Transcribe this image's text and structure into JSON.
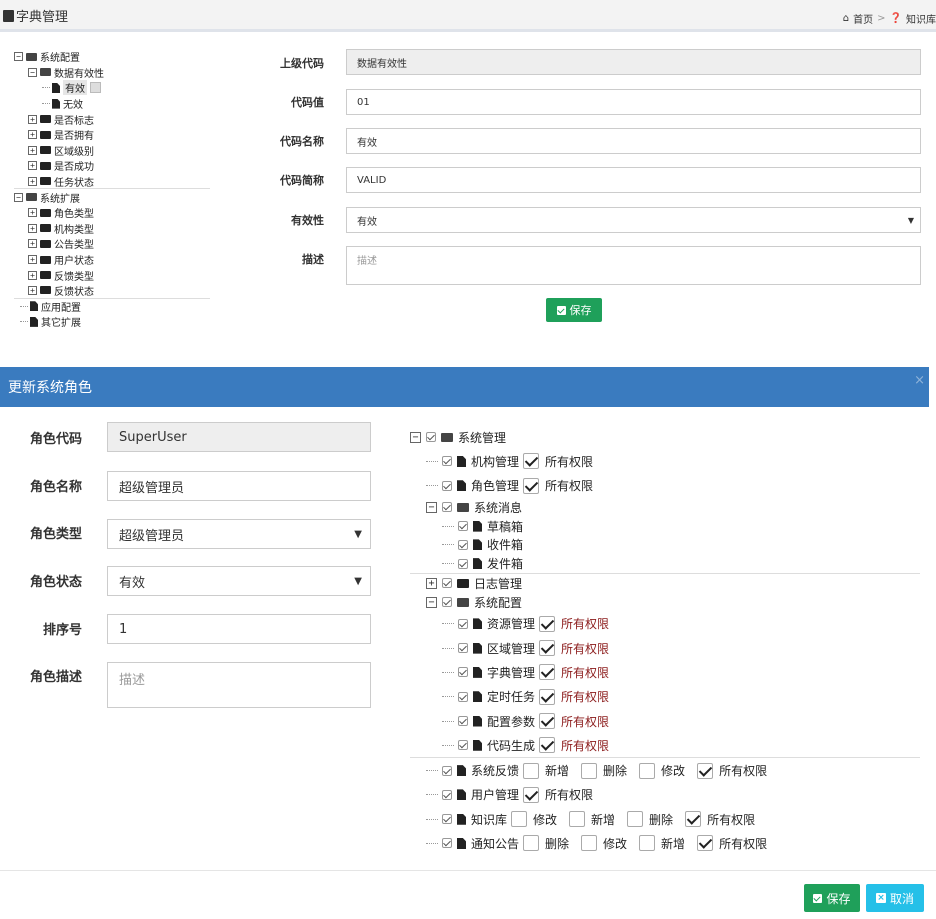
{
  "header": {
    "title": "字典管理",
    "breadcrumb": [
      "首页",
      "知识库"
    ]
  },
  "dict_tree": [
    {
      "label": "系统配置",
      "level": 0,
      "kind": "folder-open",
      "toggle": "−"
    },
    {
      "label": "数据有效性",
      "level": 1,
      "kind": "folder-open",
      "toggle": "−"
    },
    {
      "label": "有效",
      "level": 2,
      "kind": "file",
      "selected": true
    },
    {
      "label": "无效",
      "level": 2,
      "kind": "file"
    },
    {
      "label": "是否标志",
      "level": 1,
      "kind": "folder",
      "toggle": "+"
    },
    {
      "label": "是否拥有",
      "level": 1,
      "kind": "folder",
      "toggle": "+"
    },
    {
      "label": "区域级别",
      "level": 1,
      "kind": "folder",
      "toggle": "+"
    },
    {
      "label": "是否成功",
      "level": 1,
      "kind": "folder",
      "toggle": "+"
    },
    {
      "label": "任务状态",
      "level": 1,
      "kind": "folder",
      "toggle": "+"
    },
    {
      "label": "系统扩展",
      "level": 0,
      "kind": "folder-open",
      "toggle": "−"
    },
    {
      "label": "角色类型",
      "level": 1,
      "kind": "folder",
      "toggle": "+"
    },
    {
      "label": "机构类型",
      "level": 1,
      "kind": "folder",
      "toggle": "+"
    },
    {
      "label": "公告类型",
      "level": 1,
      "kind": "folder",
      "toggle": "+"
    },
    {
      "label": "用户状态",
      "level": 1,
      "kind": "folder",
      "toggle": "+"
    },
    {
      "label": "反馈类型",
      "level": 1,
      "kind": "folder",
      "toggle": "+"
    },
    {
      "label": "反馈状态",
      "level": 1,
      "kind": "folder",
      "toggle": "+"
    },
    {
      "label": "应用配置",
      "level": 0,
      "kind": "file"
    },
    {
      "label": "其它扩展",
      "level": 0,
      "kind": "file"
    }
  ],
  "dict_form": {
    "parent_code": {
      "label": "上级代码",
      "value": "数据有效性"
    },
    "code_value": {
      "label": "代码值",
      "value": "01"
    },
    "code_name": {
      "label": "代码名称",
      "value": "有效"
    },
    "code_short": {
      "label": "代码简称",
      "value": "VALID"
    },
    "validity": {
      "label": "有效性",
      "value": "有效"
    },
    "description": {
      "label": "描述",
      "placeholder": "描述"
    },
    "save_label": "保存"
  },
  "modal": {
    "title": "更新系统角色",
    "close": "×",
    "fields": {
      "role_code": {
        "label": "角色代码",
        "value": "SuperUser"
      },
      "role_name": {
        "label": "角色名称",
        "value": "超级管理员"
      },
      "role_type": {
        "label": "角色类型",
        "value": "超级管理员"
      },
      "role_status": {
        "label": "角色状态",
        "value": "有效"
      },
      "sort_no": {
        "label": "排序号",
        "value": "1"
      },
      "role_desc": {
        "label": "角色描述",
        "placeholder": "描述"
      }
    },
    "perm_tree": [
      {
        "label": "系统管理",
        "level": 0,
        "kind": "folder-open",
        "toggle": "−",
        "checked": true
      },
      {
        "label": "机构管理",
        "level": 1,
        "kind": "file",
        "checked": true,
        "perms": [
          {
            "label": "所有权限",
            "on": true
          }
        ]
      },
      {
        "label": "角色管理",
        "level": 1,
        "kind": "file",
        "checked": true,
        "perms": [
          {
            "label": "所有权限",
            "on": true
          }
        ]
      },
      {
        "label": "系统消息",
        "level": 1,
        "kind": "folder-open",
        "toggle": "−",
        "checked": true,
        "short": true
      },
      {
        "label": "草稿箱",
        "level": 2,
        "kind": "file",
        "checked": true,
        "short": true
      },
      {
        "label": "收件箱",
        "level": 2,
        "kind": "file",
        "checked": true,
        "short": true
      },
      {
        "label": "发件箱",
        "level": 2,
        "kind": "file",
        "checked": true,
        "short": true
      },
      {
        "label": "日志管理",
        "level": 1,
        "kind": "folder",
        "toggle": "+",
        "checked": true,
        "short": true
      },
      {
        "label": "系统配置",
        "level": 1,
        "kind": "folder-open",
        "toggle": "−",
        "checked": true,
        "short": true
      },
      {
        "label": "资源管理",
        "level": 2,
        "kind": "file",
        "checked": true,
        "perms": [
          {
            "label": "所有权限",
            "on": true,
            "red": true
          }
        ]
      },
      {
        "label": "区域管理",
        "level": 2,
        "kind": "file",
        "checked": true,
        "perms": [
          {
            "label": "所有权限",
            "on": true,
            "red": true
          }
        ]
      },
      {
        "label": "字典管理",
        "level": 2,
        "kind": "file",
        "checked": true,
        "perms": [
          {
            "label": "所有权限",
            "on": true,
            "red": true
          }
        ]
      },
      {
        "label": "定时任务",
        "level": 2,
        "kind": "file",
        "checked": true,
        "perms": [
          {
            "label": "所有权限",
            "on": true,
            "red": true
          }
        ]
      },
      {
        "label": "配置参数",
        "level": 2,
        "kind": "file",
        "checked": true,
        "perms": [
          {
            "label": "所有权限",
            "on": true,
            "red": true
          }
        ]
      },
      {
        "label": "代码生成",
        "level": 2,
        "kind": "file",
        "checked": true,
        "perms": [
          {
            "label": "所有权限",
            "on": true,
            "red": true
          }
        ]
      },
      {
        "label": "系统反馈",
        "level": 1,
        "kind": "file",
        "checked": true,
        "perms": [
          {
            "label": "新增",
            "on": false
          },
          {
            "label": "删除",
            "on": false
          },
          {
            "label": "修改",
            "on": false
          },
          {
            "label": "所有权限",
            "on": true
          }
        ]
      },
      {
        "label": "用户管理",
        "level": 1,
        "kind": "file",
        "checked": true,
        "perms": [
          {
            "label": "所有权限",
            "on": true
          }
        ]
      },
      {
        "label": "知识库",
        "level": 1,
        "kind": "file",
        "checked": true,
        "perms": [
          {
            "label": "修改",
            "on": false
          },
          {
            "label": "新增",
            "on": false
          },
          {
            "label": "删除",
            "on": false
          },
          {
            "label": "所有权限",
            "on": true
          }
        ]
      },
      {
        "label": "通知公告",
        "level": 1,
        "kind": "file",
        "checked": true,
        "perms": [
          {
            "label": "删除",
            "on": false
          },
          {
            "label": "修改",
            "on": false
          },
          {
            "label": "新增",
            "on": false
          },
          {
            "label": "所有权限",
            "on": true
          }
        ]
      }
    ],
    "save_label": "保存",
    "cancel_label": "取消"
  }
}
